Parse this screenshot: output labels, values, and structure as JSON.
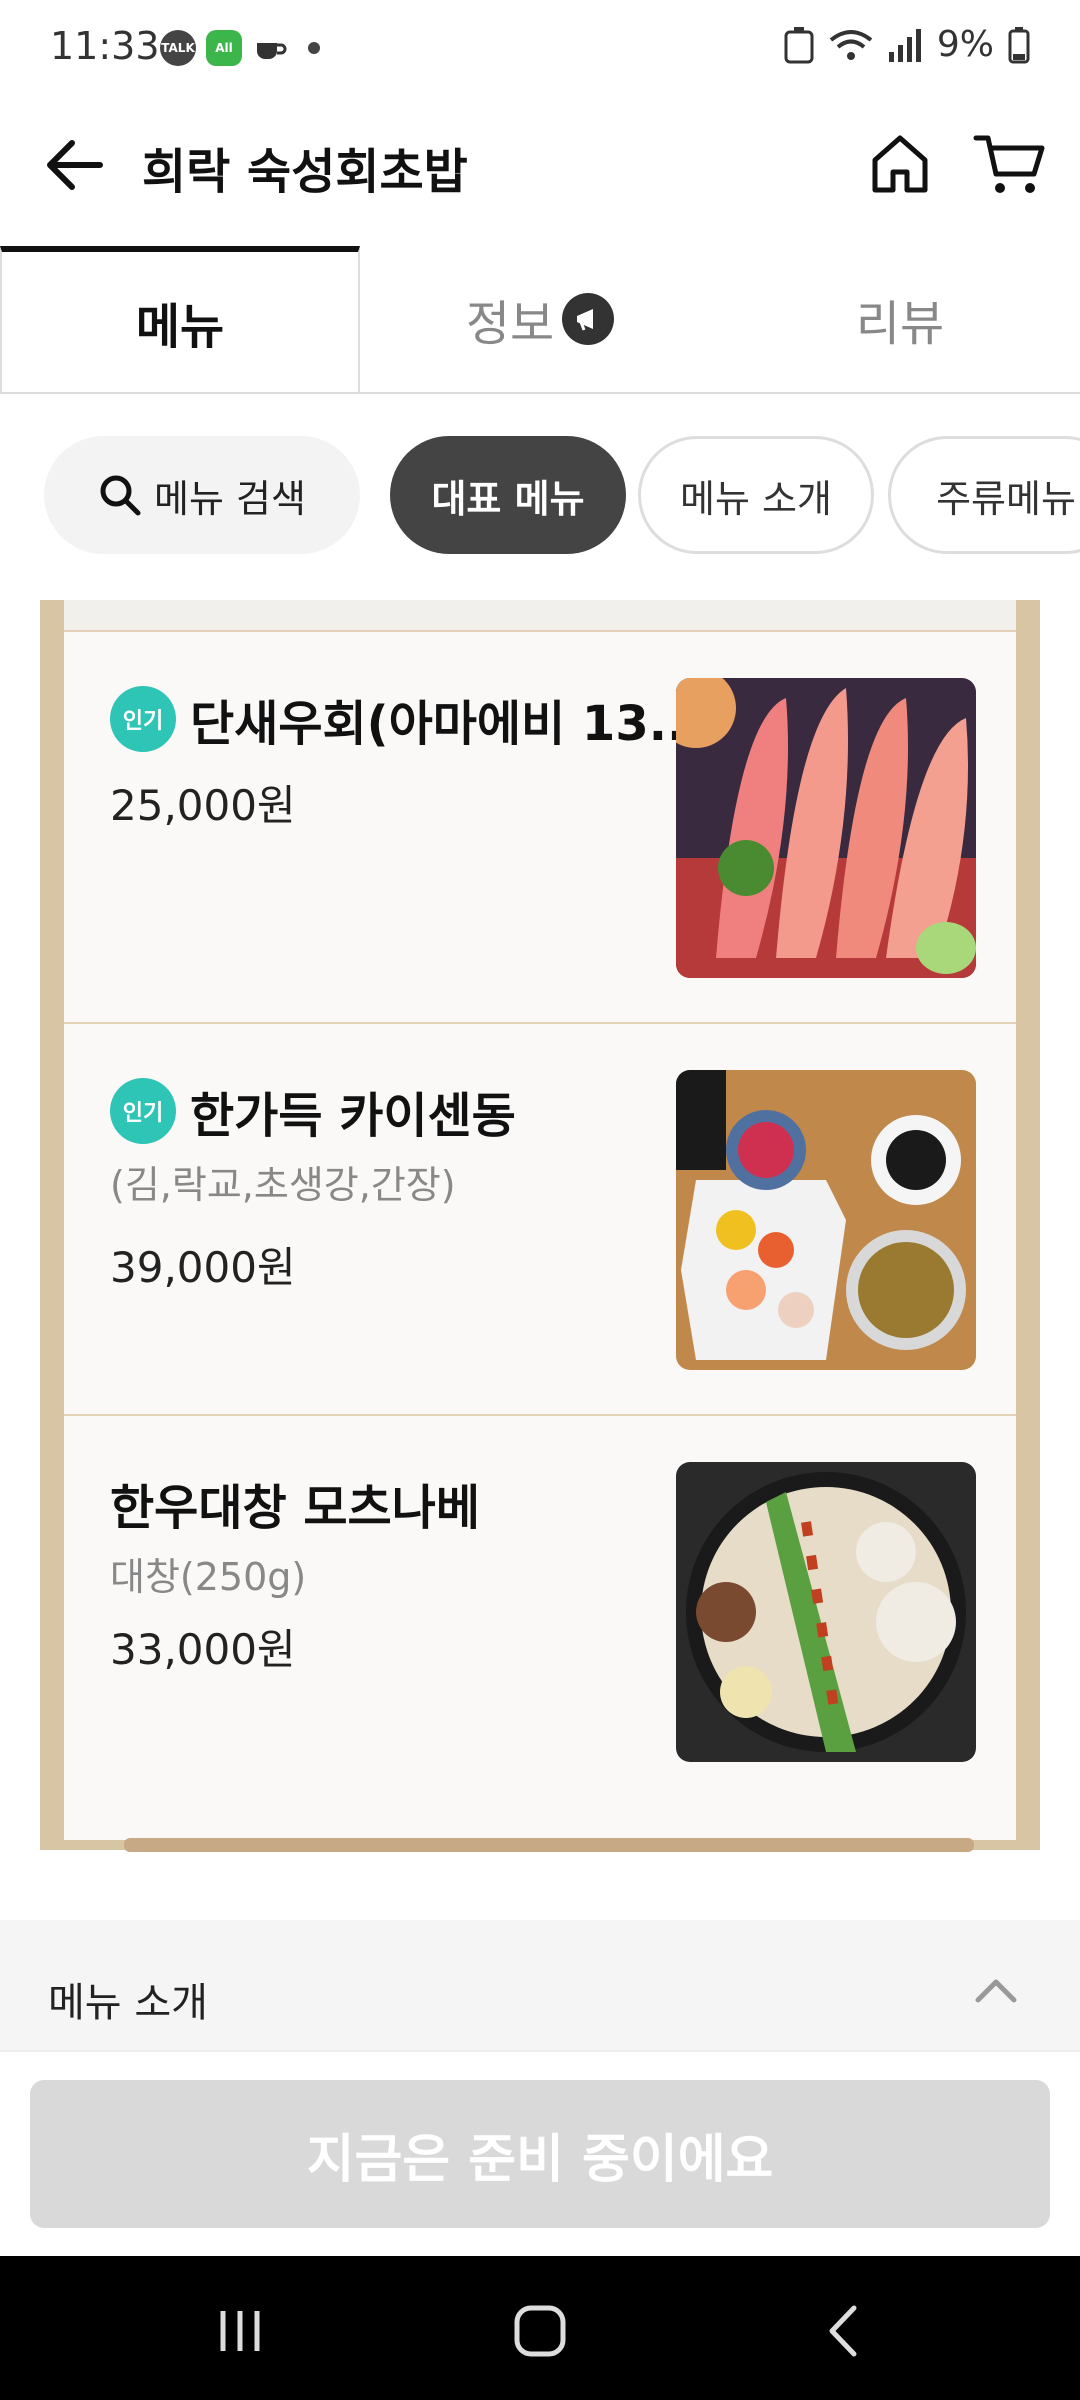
{
  "status_bar": {
    "time": "11:33",
    "battery": "9%",
    "notif_icons": [
      "talk-icon",
      "app-icon",
      "coffee-icon",
      "dot-icon"
    ]
  },
  "header": {
    "title": "희락 숙성회초밥"
  },
  "tabs": [
    {
      "label": "메뉴",
      "active": true
    },
    {
      "label": "정보",
      "active": false
    },
    {
      "label": "리뷰",
      "active": false
    }
  ],
  "chips": {
    "search_label": "메뉴 검색",
    "items": [
      "대표 메뉴",
      "메뉴 소개",
      "주류메뉴"
    ]
  },
  "menu_items": [
    {
      "popular_badge": "인기",
      "name": "단새우회(아마에비 13...",
      "desc": "",
      "price": "25,000원"
    },
    {
      "popular_badge": "인기",
      "name": "한가득 카이센동",
      "desc": "(김,락교,초생강,간장)",
      "price": "39,000원"
    },
    {
      "popular_badge": "",
      "name": "한우대창 모츠나베",
      "desc": "대창(250g)",
      "price": "33,000원"
    }
  ],
  "intro_section": {
    "label": "메뉴 소개"
  },
  "cta": {
    "label": "지금은 준비 중이에요"
  },
  "colors": {
    "popular_badge": "#2ec4b6",
    "active_chip": "#444444",
    "cta_disabled": "#d9d9d9",
    "board_frame": "#d8c5a3"
  }
}
